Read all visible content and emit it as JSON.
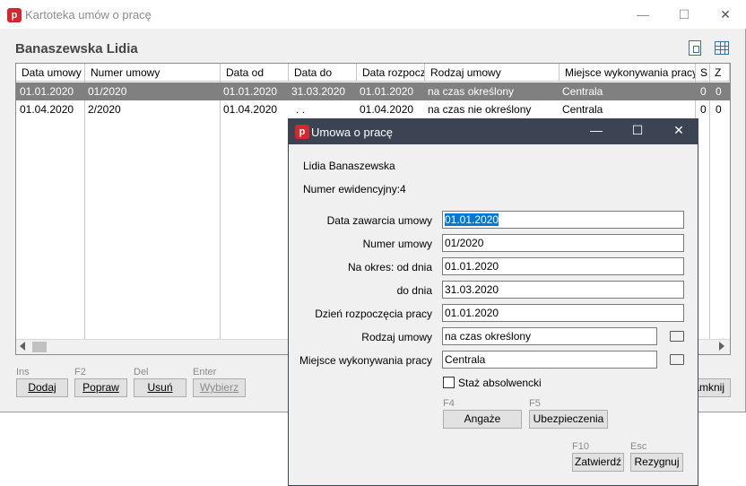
{
  "main_window": {
    "title": "Kartoteka umów o pracę",
    "heading": "Banaszewska Lidia",
    "caption_buttons": {
      "minimize": "—",
      "maximize": "☐",
      "close": "✕"
    },
    "table": {
      "columns": [
        "Data umowy",
        "Numer umowy",
        "Data od",
        "Data do",
        "Data rozpoczę",
        "Rodzaj umowy",
        "Miejsce wykonywania pracy",
        "S",
        "Z"
      ],
      "rows": [
        [
          "01.01.2020",
          "01/2020",
          "01.01.2020",
          "31.03.2020",
          "01.01.2020",
          "na czas określony",
          "Centrala",
          "0",
          "0"
        ],
        [
          "01.04.2020",
          "2/2020",
          "01.04.2020",
          " .  .",
          "01.04.2020",
          "na czas nie określony",
          "Centrala",
          "0",
          "0"
        ]
      ]
    },
    "buttons": [
      {
        "key": "Ins",
        "label": "Dodaj"
      },
      {
        "key": "F2",
        "label": "Popraw"
      },
      {
        "key": "Del",
        "label": "Usuń"
      },
      {
        "key": "Enter",
        "label": "Wybierz"
      }
    ],
    "close_button_partial": "amknij"
  },
  "dialog": {
    "title": "Umowa o pracę",
    "person_name": "Lidia Banaszewska",
    "evid_label": "Numer ewidencyjny:",
    "evid_value": "4",
    "fields": {
      "contract_date": {
        "label": "Data zawarcia umowy",
        "value": "01.01.2020"
      },
      "contract_number": {
        "label": "Numer umowy",
        "value": "01/2020"
      },
      "period_from": {
        "label": "Na okres:  od dnia",
        "value": "01.01.2020"
      },
      "period_to": {
        "label": "do dnia",
        "value": "31.03.2020"
      },
      "start_date": {
        "label": "Dzień rozpoczęcia pracy",
        "value": "01.01.2020"
      },
      "contract_type": {
        "label": "Rodzaj umowy",
        "value": "na czas określony"
      },
      "workplace": {
        "label": "Miejsce wykonywania pracy",
        "value": "Centrala"
      }
    },
    "checkbox_label": "Staż absolwencki",
    "buttons": {
      "engagements": {
        "key": "F4",
        "label": "Angaże"
      },
      "insurance": {
        "key": "F5",
        "label": "Ubezpieczenia"
      },
      "confirm": {
        "key": "F10",
        "label": "Zatwierdź"
      },
      "cancel": {
        "key": "Esc",
        "label": "Rezygnuj"
      }
    }
  },
  "colors": {
    "selected_row": "#808080",
    "dialog_titlebar": "#3c4352",
    "app_icon": "#d9262e",
    "selection": "#0078d7"
  }
}
